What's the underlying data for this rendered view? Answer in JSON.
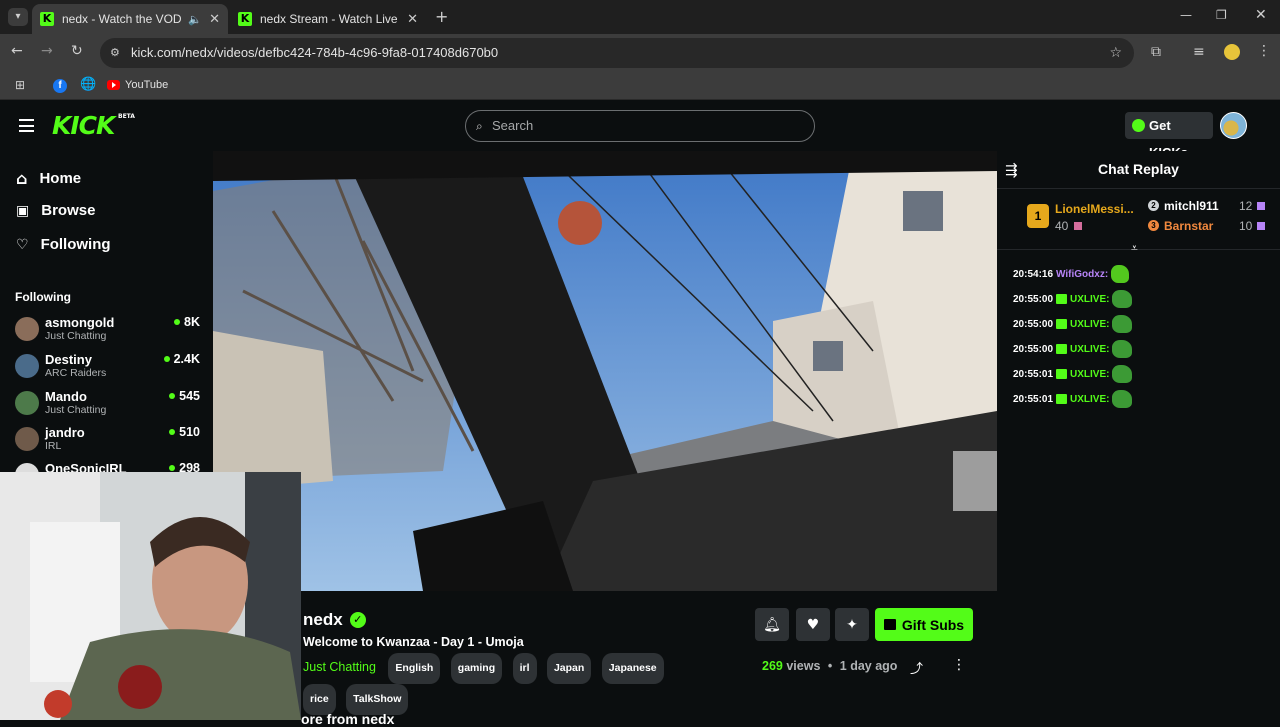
{
  "browser": {
    "tabs": [
      {
        "title": "nedx - Watch the VOD on K",
        "active": true
      },
      {
        "title": "nedx Stream - Watch Live on K",
        "active": false
      }
    ],
    "url": "kick.com/nedx/videos/defbc424-784b-4c96-9fa8-017408d670b0",
    "bookmarks": [
      {
        "label": "YouTube"
      }
    ]
  },
  "header": {
    "logo": "KICK",
    "logo_badge": "BETA",
    "search_placeholder": "Search",
    "get_kicks_label": "Get KICKs"
  },
  "sidebar": {
    "nav": [
      {
        "label": "Home",
        "icon": "home-icon"
      },
      {
        "label": "Browse",
        "icon": "browse-icon"
      },
      {
        "label": "Following",
        "icon": "heart-icon"
      }
    ],
    "following_heading": "Following",
    "channels": [
      {
        "name": "asmongold",
        "category": "Just Chatting",
        "viewers": "8K"
      },
      {
        "name": "Destiny",
        "category": "ARC Raiders",
        "viewers": "2.4K"
      },
      {
        "name": "Mando",
        "category": "Just Chatting",
        "viewers": "545"
      },
      {
        "name": "jandro",
        "category": "IRL",
        "viewers": "510"
      },
      {
        "name": "OneSonicIRL",
        "category": "",
        "viewers": "298"
      }
    ]
  },
  "stream": {
    "channel": "nedx",
    "title": "Welcome to Kwanzaa - Day 1 - Umoja",
    "category": "Just Chatting",
    "tags": [
      "English",
      "gaming",
      "irl",
      "Japan",
      "Japanese",
      "rice",
      "TalkShow"
    ],
    "views_count": "269",
    "views_label": "views",
    "age": "1 day ago",
    "gift_subs_label": "Gift Subs",
    "more_from": "ore from nedx"
  },
  "chat": {
    "title": "Chat Replay",
    "leaderboard": [
      {
        "rank": "1",
        "name": "LionelMessi...",
        "count": "40"
      },
      {
        "rank": "2",
        "name": "mitchl911",
        "count": "12"
      },
      {
        "rank": "3",
        "name": "Barnstar",
        "count": "10"
      }
    ],
    "messages": [
      {
        "time": "20:54:16",
        "user": "WifiGodxz:",
        "color": "#b784f7",
        "gift": false
      },
      {
        "time": "20:55:00",
        "user": "UXLIVE:",
        "color": "#53fc18",
        "gift": true
      },
      {
        "time": "20:55:00",
        "user": "UXLIVE:",
        "color": "#53fc18",
        "gift": true
      },
      {
        "time": "20:55:00",
        "user": "UXLIVE:",
        "color": "#53fc18",
        "gift": true
      },
      {
        "time": "20:55:01",
        "user": "UXLIVE:",
        "color": "#53fc18",
        "gift": true
      },
      {
        "time": "20:55:01",
        "user": "UXLIVE:",
        "color": "#53fc18",
        "gift": true
      }
    ]
  },
  "colors": {
    "accent": "#53fc18",
    "background": "#0b0e0f",
    "gold": "#e6a81c",
    "bronze": "#f0883e"
  }
}
